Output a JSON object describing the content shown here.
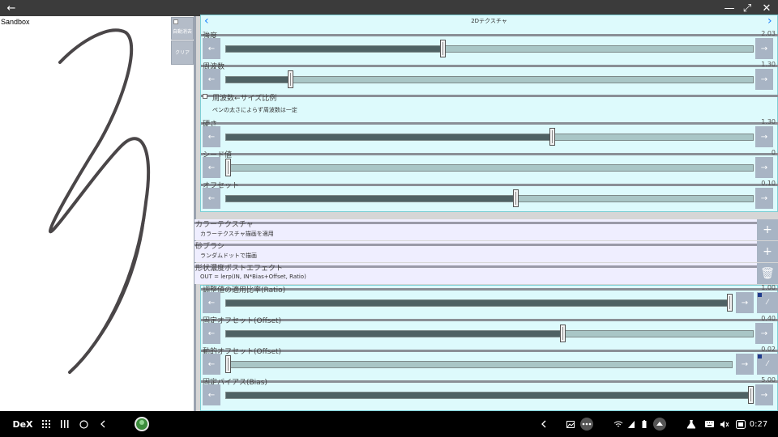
{
  "titlebar": {
    "back_icon": "←",
    "minimize_icon": "—",
    "expand_icon": "⤢",
    "close_icon": "✕"
  },
  "sandbox": {
    "label": "Sandbox",
    "auto_clear_label": "自動消去",
    "clear_button": "クリア"
  },
  "texture": {
    "title": "2Dテクスチャ",
    "prev": "‹",
    "next": "›",
    "params": [
      {
        "label": "強度",
        "value": "2.03",
        "fraction": 0.41
      },
      {
        "label": "周波数",
        "value": "1.30",
        "fraction": 0.12
      },
      {
        "label": "硬さ",
        "value": "1.30",
        "fraction": 0.62
      },
      {
        "label": "シード値",
        "value": "0",
        "fraction": 0.0
      },
      {
        "label": "オフセット",
        "value": "0.10",
        "fraction": 0.55
      }
    ],
    "checkbox": {
      "label": "周波数←サイズ比例",
      "desc": "ペンの太さによらず周波数は一定"
    },
    "left_arrow": "←",
    "right_arrow": "→"
  },
  "sections": [
    {
      "label": "カラーテクスチャ",
      "desc": "カラーテクスチャ描画を適用",
      "action": "+"
    },
    {
      "label": "砂ブラシ",
      "desc": "ランダムドットで描画",
      "action": "+"
    },
    {
      "label": "形状濃度ポストエフェクト",
      "desc": "OUT = lerp(IN, IN*Bias+Offset, Ratio)",
      "action": "🗑"
    }
  ],
  "ratio": {
    "params": [
      {
        "label": "調整値の適用比率(Ratio)",
        "value": "1.00",
        "fraction": 1.0
      },
      {
        "label": "固定オフセット(Offset)",
        "value": "0.40",
        "fraction": 0.64
      },
      {
        "label": "動的オフセット(Offset)",
        "value": "0.02",
        "fraction": 0.0
      },
      {
        "label": "固定バイアス(Bias)",
        "value": "5.00",
        "fraction": 1.0
      }
    ],
    "curve_icon": "⁄"
  },
  "taskbar": {
    "dex_label": "DeX",
    "time": "0:27"
  },
  "colors": {
    "accent": "#1a80ff",
    "panel_cyan": "#ddfafc",
    "section_lavender": "#efeeff",
    "button": "#a8b4c4"
  }
}
